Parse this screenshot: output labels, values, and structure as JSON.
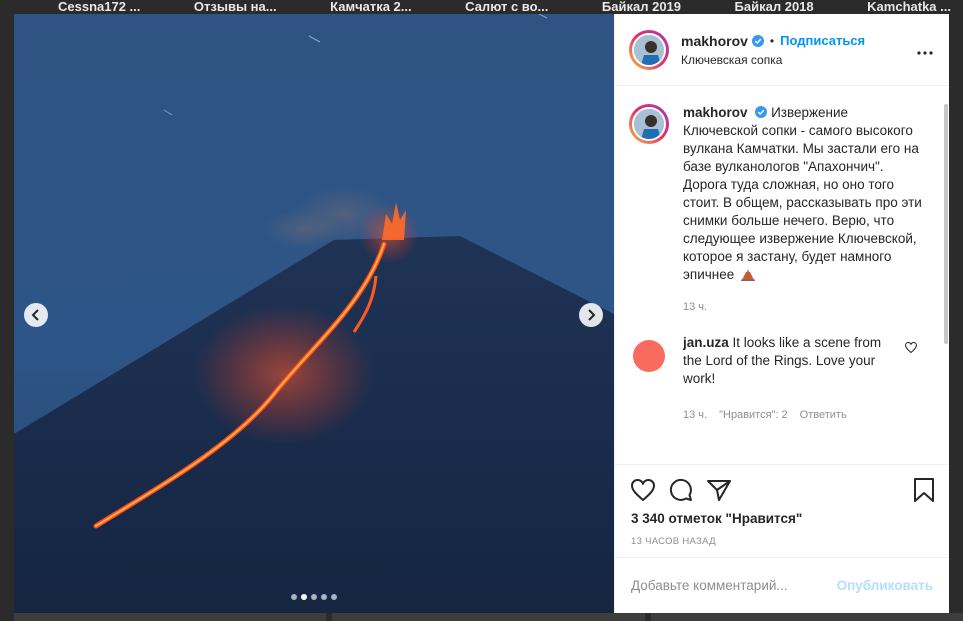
{
  "highlights": [
    "Cessna172 ...",
    "Отзывы на...",
    "Камчатка 2...",
    "Салют с во...",
    "Байкал 2019",
    "Байкал 2018",
    "Kamchatka ..."
  ],
  "post": {
    "username": "makhorov",
    "follow_label": "Подписаться",
    "location": "Ключевская сопка",
    "caption": "Извержение Ключевской сопки - самого высокого вулкана Камчатки. Мы застали его на базе вулканологов \"Апахончич\". Дорога туда сложная, но оно того стоит. В общем, рассказывать про эти снимки больше нечего. Верю, что следующее извержение Ключевской, которое я застану, будет намного эпичнее",
    "caption_time": "13 ч.",
    "carousel": {
      "count": 5,
      "active_index": 1
    },
    "comments": [
      {
        "username": "jan.uza",
        "text": "It looks like a scene from the Lord of the Rings. Love your work!",
        "time": "13 ч.",
        "likes_label": "\"Нравится\": 2",
        "reply_label": "Ответить"
      }
    ],
    "likes_text": "3 340 отметок \"Нравится\"",
    "timestamp": "13 часов назад",
    "comment_placeholder": "Добавьте комментарий...",
    "publish_label": "Опубликовать"
  },
  "icons": {
    "verified": "verified-badge-icon",
    "more": "more-options-icon",
    "like": "heart-icon",
    "comment": "comment-icon",
    "share": "share-icon",
    "save": "bookmark-icon",
    "prev": "chevron-left-icon",
    "next": "chevron-right-icon",
    "volcano_emoji": "volcano-icon"
  },
  "colors": {
    "accent": "#0095f6",
    "publish_disabled": "#b2dffc",
    "muted": "#8e8e8e"
  }
}
